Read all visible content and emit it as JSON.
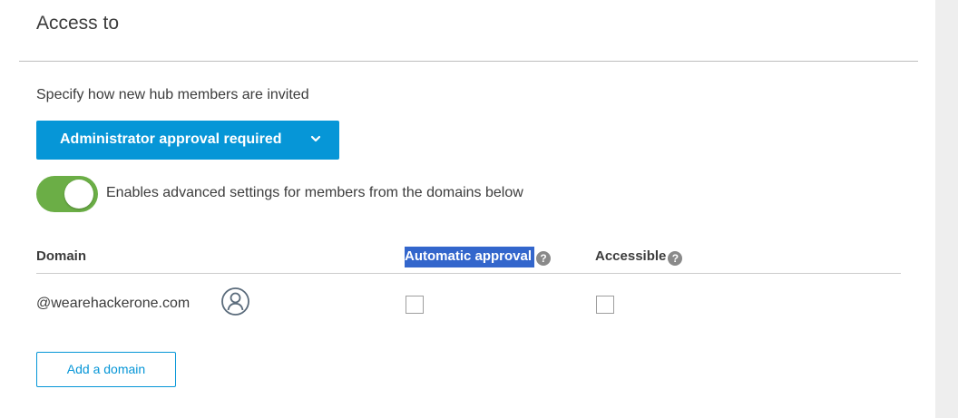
{
  "header": {
    "title": "Access to"
  },
  "invite": {
    "label": "Specify how new hub members are invited",
    "dropdown_value": "Administrator approval required"
  },
  "advanced_toggle": {
    "state": "on",
    "label": "Enables advanced settings for members from the domains below"
  },
  "domains_table": {
    "columns": {
      "domain": "Domain",
      "automatic_approval": "Automatic approval",
      "accessible": "Accessible"
    },
    "help_glyph": "?",
    "rows": [
      {
        "domain": "@wearehackerone.com",
        "automatic_approval": false,
        "accessible": false
      }
    ]
  },
  "add_domain_label": "Add a domain",
  "icons": {
    "chevron": "chevron-down-icon",
    "help": "help-icon",
    "user": "user-icon"
  },
  "colors": {
    "primary": "#0696d7",
    "toggle_on": "#6bae46",
    "selection": "#3366cc"
  }
}
